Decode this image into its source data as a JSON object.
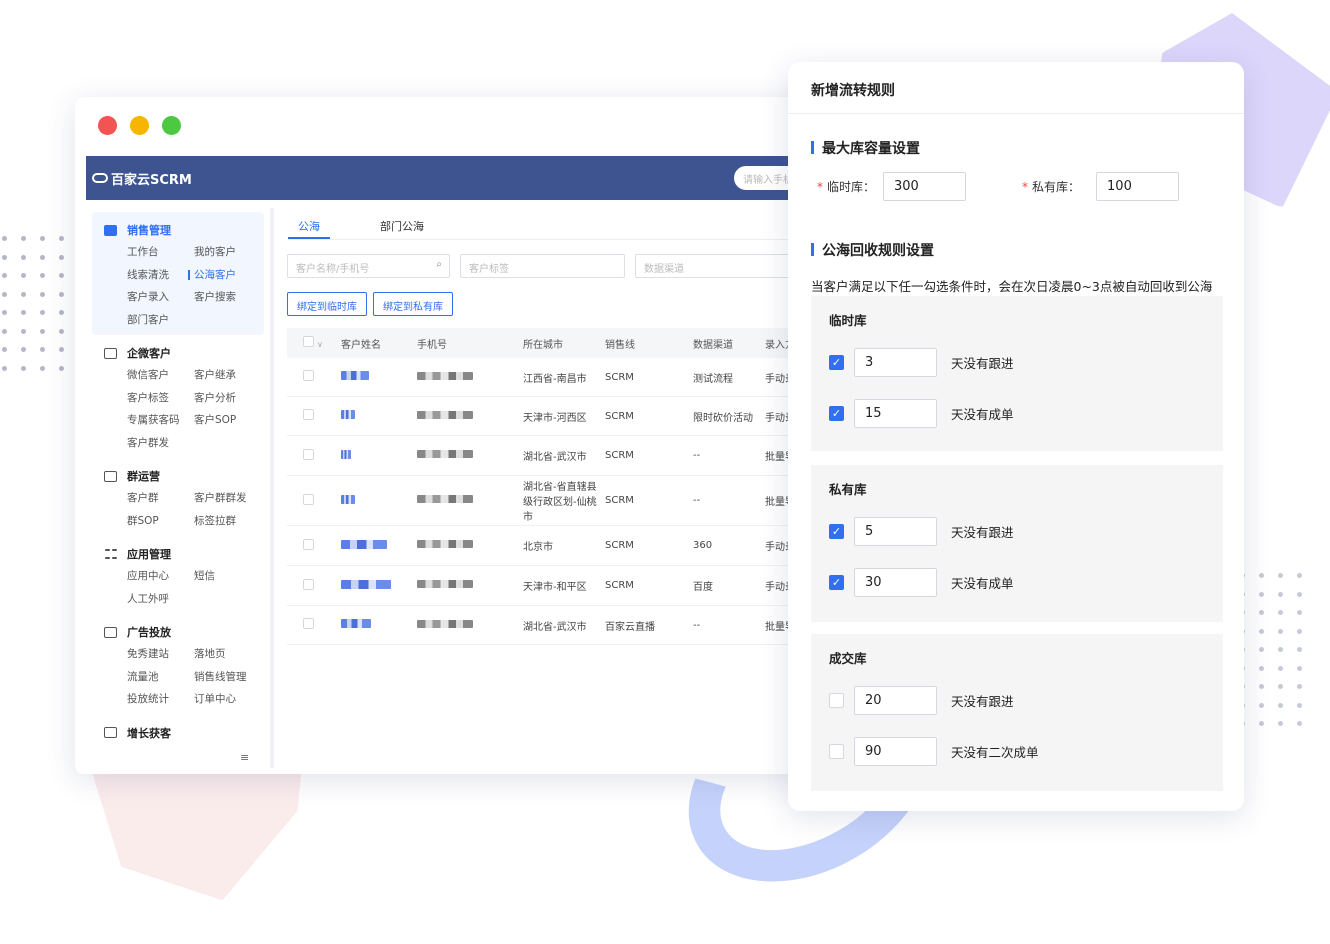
{
  "app": {
    "logo_text": "百家云SCRM",
    "search_placeholder": "请输入手机"
  },
  "sidebar": {
    "groups": [
      {
        "title": "销售管理",
        "items": [
          "工作台",
          "我的客户",
          "线索清洗",
          "公海客户",
          "客户录入",
          "客户搜索",
          "部门客户"
        ]
      },
      {
        "title": "企微客户",
        "items": [
          "微信客户",
          "客户继承",
          "客户标签",
          "客户分析",
          "专属获客码",
          "客户SOP",
          "客户群发"
        ]
      },
      {
        "title": "群运营",
        "items": [
          "客户群",
          "客户群群发",
          "群SOP",
          "标签拉群"
        ]
      },
      {
        "title": "应用管理",
        "items": [
          "应用中心",
          "短信",
          "人工外呼"
        ]
      },
      {
        "title": "广告投放",
        "items": [
          "免秀建站",
          "落地页",
          "流量池",
          "销售线管理",
          "投放统计",
          "订单中心"
        ]
      },
      {
        "title": "增长获客",
        "items": []
      }
    ],
    "collapse_icon": "≡"
  },
  "content": {
    "tabs": [
      "公海",
      "部门公海"
    ],
    "filters": {
      "name_phone": "客户名称/手机号",
      "tag": "客户标签",
      "channel": "数据渠道"
    },
    "buttons": {
      "bind_temp": "绑定到临时库",
      "bind_private": "绑定到私有库"
    },
    "columns": [
      "客户姓名",
      "手机号",
      "所在城市",
      "销售线",
      "数据渠道",
      "录入方"
    ],
    "rows": [
      {
        "city": "江西省-南昌市",
        "line": "SCRM",
        "channel": "测试流程",
        "entry": "手动录"
      },
      {
        "city": "天津市-河西区",
        "line": "SCRM",
        "channel": "限时砍价活动",
        "entry": "手动录"
      },
      {
        "city": "湖北省-武汉市",
        "line": "SCRM",
        "channel": "--",
        "entry": "批量导"
      },
      {
        "city": "湖北省-省直辖县级行政区划-仙桃市",
        "line": "SCRM",
        "channel": "--",
        "entry": "批量导"
      },
      {
        "city": "北京市",
        "line": "SCRM",
        "channel": "360",
        "entry": "手动录"
      },
      {
        "city": "天津市-和平区",
        "line": "SCRM",
        "channel": "百度",
        "entry": "手动录"
      },
      {
        "city": "湖北省-武汉市",
        "line": "百家云直播",
        "channel": "--",
        "entry": "批量导"
      }
    ]
  },
  "dialog": {
    "title": "新增流转规则",
    "capacity_title": "最大库容量设置",
    "temp_label": "临时库：",
    "temp_value": "300",
    "private_label": "私有库：",
    "private_value": "100",
    "recycle_title": "公海回收规则设置",
    "recycle_desc": "当客户满足以下任一勾选条件时，会在次日凌晨0~3点被自动回收到公海",
    "boxes": [
      {
        "title": "临时库",
        "rules": [
          {
            "checked": true,
            "value": "3",
            "text": "天没有跟进"
          },
          {
            "checked": true,
            "value": "15",
            "text": "天没有成单"
          }
        ]
      },
      {
        "title": "私有库",
        "rules": [
          {
            "checked": true,
            "value": "5",
            "text": "天没有跟进"
          },
          {
            "checked": true,
            "value": "30",
            "text": "天没有成单"
          }
        ]
      },
      {
        "title": "成交库",
        "rules": [
          {
            "checked": false,
            "value": "20",
            "text": "天没有跟进"
          },
          {
            "checked": false,
            "value": "90",
            "text": "天没有二次成单"
          }
        ]
      }
    ]
  },
  "colors": {
    "primary": "#2f6ff0",
    "topbar": "#3d5491"
  }
}
